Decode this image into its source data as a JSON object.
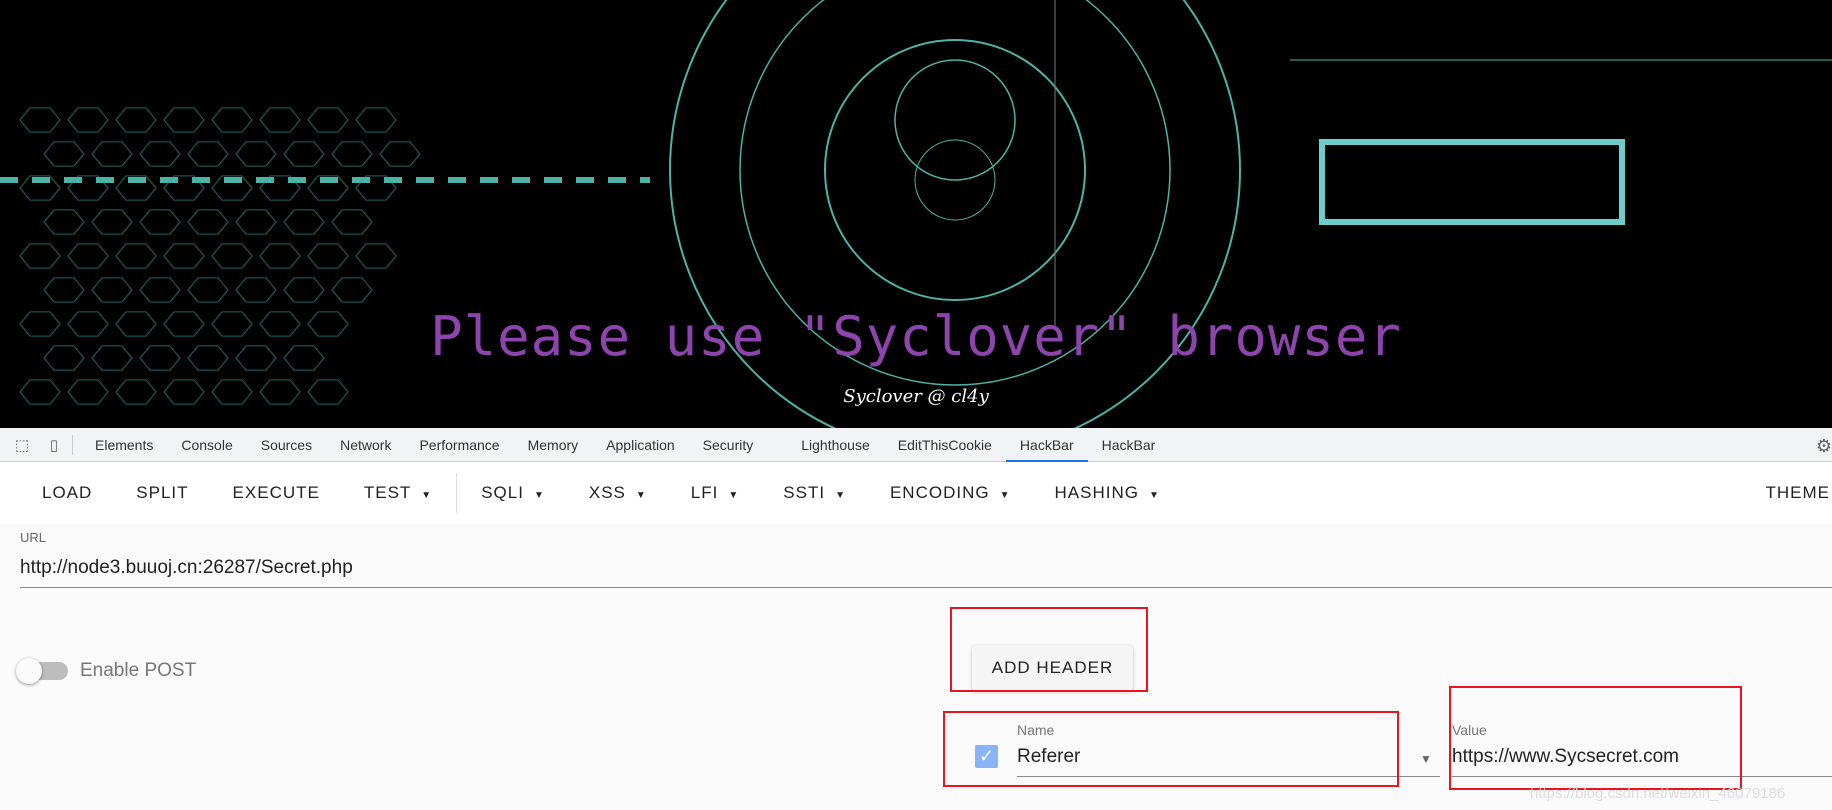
{
  "banner": {
    "headline": "Please use \"Syclover\" browser",
    "byline": "Syclover @ cl4y",
    "headline_color": "#8e44ad"
  },
  "devtools": {
    "tabs": [
      "Elements",
      "Console",
      "Sources",
      "Network",
      "Performance",
      "Memory",
      "Application",
      "Security",
      "Lighthouse",
      "EditThisCookie",
      "HackBar",
      "HackBar"
    ],
    "active_tab": "HackBar",
    "icons": [
      "inspect-icon",
      "device-toolbar-icon",
      "gear-icon"
    ]
  },
  "hackbar": {
    "toolbar": {
      "load": "LOAD",
      "split": "SPLIT",
      "execute": "EXECUTE",
      "test": "TEST",
      "sqli": "SQLI",
      "xss": "XSS",
      "lfi": "LFI",
      "ssti": "SSTI",
      "encoding": "ENCODING",
      "hashing": "HASHING",
      "theme": "THEME"
    },
    "url": {
      "label": "URL",
      "value": "http://node3.buuoj.cn:26287/Secret.php"
    },
    "enable_post": {
      "label": "Enable POST",
      "checked": false
    },
    "add_header": "ADD HEADER",
    "header": {
      "enabled": true,
      "name_label": "Name",
      "name_value": "Referer",
      "value_label": "Value",
      "value_value": "https://www.Sycsecret.com"
    }
  },
  "watermark": "https://blog.csdn.net/weixin_46079186",
  "accent": "#1a73e8",
  "annotation_color": "#e8141e"
}
